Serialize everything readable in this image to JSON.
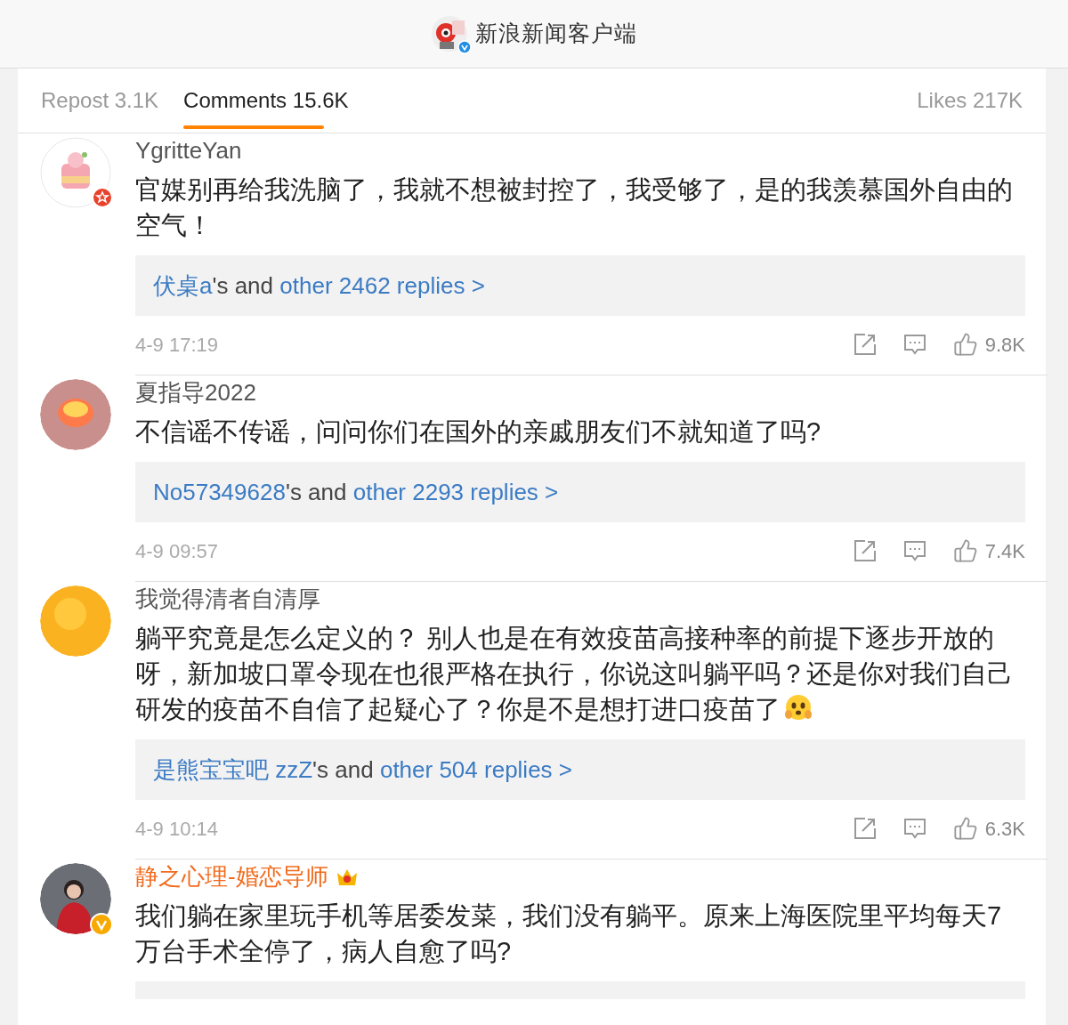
{
  "header": {
    "title": "新浪新闻客户端",
    "verified": true
  },
  "tabs": [
    {
      "label": "Repost 3.1K",
      "selected": false
    },
    {
      "label": "Comments 15.6K",
      "selected": true
    },
    {
      "label": "Likes 217K",
      "selected": false
    }
  ],
  "comments": [
    {
      "user": "YgritteYan",
      "vip": false,
      "star_badge": true,
      "verified": false,
      "text": "官媒别再给我洗脑了，我就不想被封控了，我受够了，是的我羡慕国外自由的空气！",
      "emoji": false,
      "replies": {
        "user": "伏桌a",
        "joiner": "'s and",
        "count": "other 2462 replies >"
      },
      "time": "4-9 17:19",
      "likes": "9.8K"
    },
    {
      "user": "夏指导2022",
      "vip": false,
      "star_badge": false,
      "verified": false,
      "text": "不信谣不传谣，问问你们在国外的亲戚朋友们不就知道了吗?",
      "emoji": false,
      "replies": {
        "user": "No57349628",
        "joiner": "'s and",
        "count": "other 2293 replies >"
      },
      "time": "4-9 09:57",
      "likes": "7.4K"
    },
    {
      "user": "我觉得清者自清厚",
      "vip": false,
      "star_badge": false,
      "verified": false,
      "text": "躺平究竟是怎么定义的？ 别人也是在有效疫苗高接种率的前提下逐步开放的呀，新加坡口罩令现在也很严格在执行，你说这叫躺平吗？还是你对我们自己研发的疫苗不自信了起疑心了？你是不是想打进口疫苗了",
      "emoji": true,
      "replies": {
        "user": "是熊宝宝吧 zzZ",
        "joiner": "'s and",
        "count": "other 504 replies >"
      },
      "time": "4-9 10:14",
      "likes": "6.3K"
    },
    {
      "user": "静之心理-婚恋导师",
      "vip": true,
      "star_badge": false,
      "verified": true,
      "text": "我们躺在家里玩手机等居委发菜，我们没有躺平。原来上海医院里平均每天7万台手术全停了，病人自愈了吗?",
      "emoji": false
    }
  ]
}
